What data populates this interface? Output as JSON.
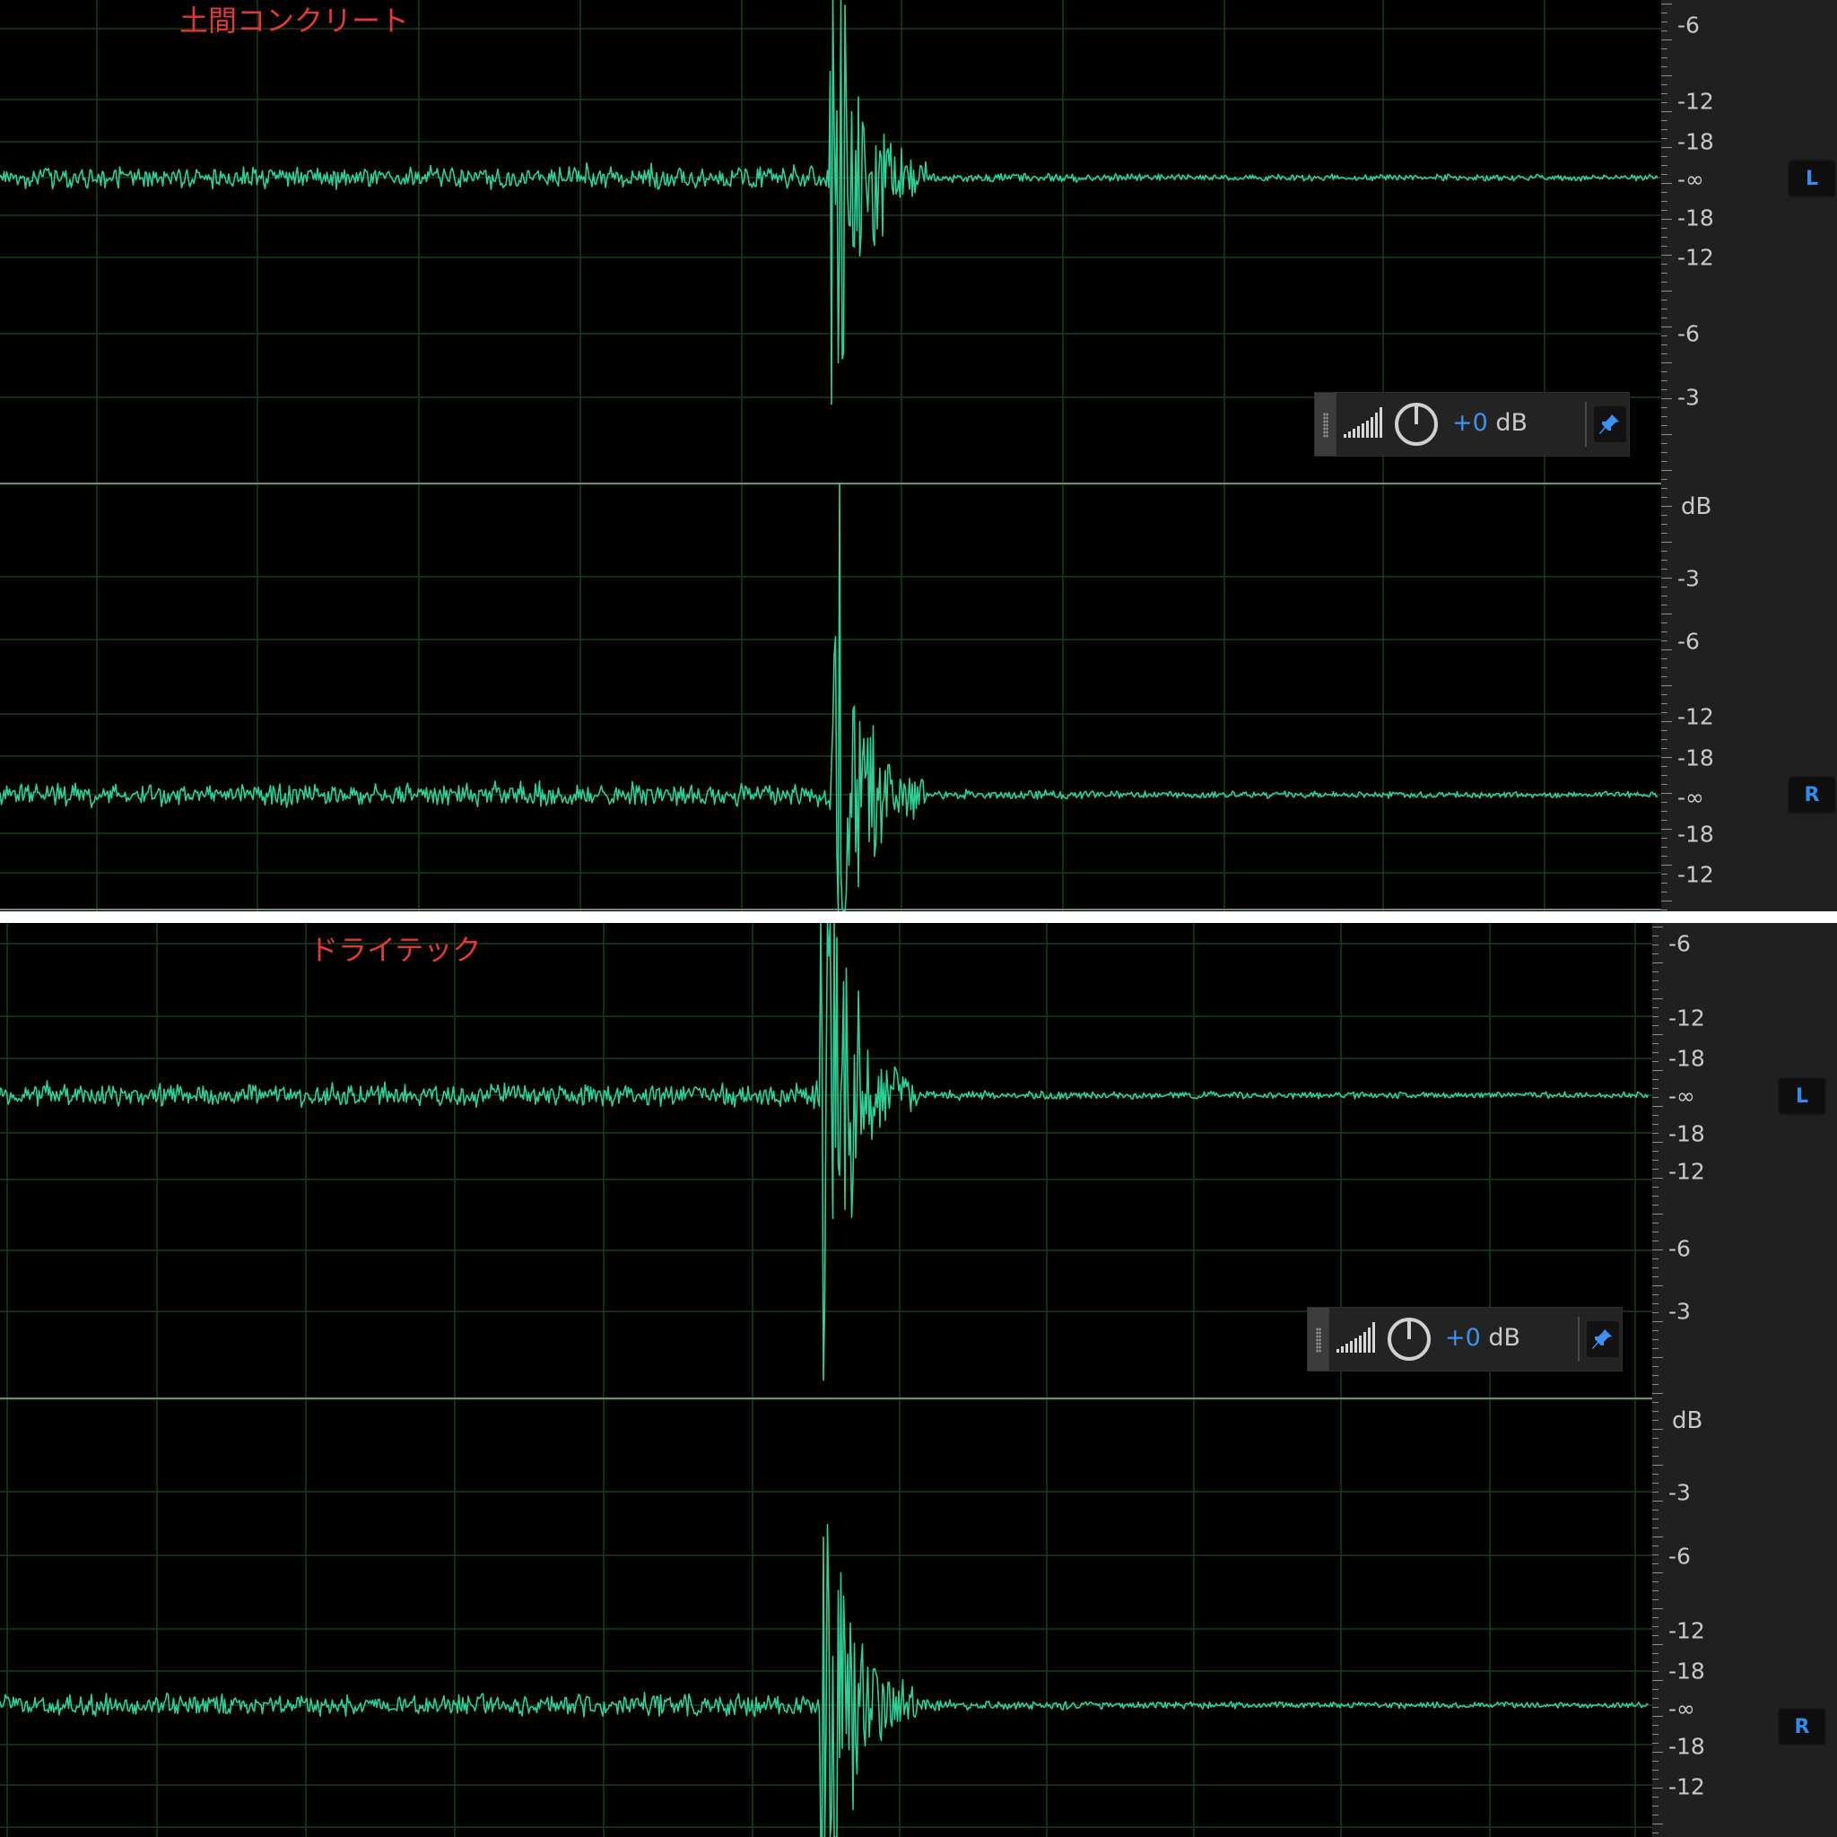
{
  "panels": [
    {
      "title": "土間コンクリート",
      "ruler": {
        "unit": "dB",
        "top_channel_labels": [
          "-6",
          "-12",
          "-18",
          "-∞",
          "-18",
          "-12",
          "-6",
          "-3"
        ],
        "bottom_channel_labels": [
          "-3",
          "-6",
          "-12",
          "-18",
          "-∞",
          "-18",
          "-12"
        ]
      },
      "channels": [
        "L",
        "R"
      ],
      "gain_hud": {
        "gain_value": "+0",
        "gain_unit": " dB"
      }
    },
    {
      "title": "ドライテック",
      "ruler": {
        "unit": "dB",
        "top_channel_labels": [
          "-6",
          "-12",
          "-18",
          "-∞",
          "-18",
          "-12",
          "-6",
          "-3"
        ],
        "bottom_channel_labels": [
          "-3",
          "-6",
          "-12",
          "-18",
          "-∞",
          "-18",
          "-12"
        ]
      },
      "channels": [
        "L",
        "R"
      ],
      "gain_hud": {
        "gain_value": "+0",
        "gain_unit": " dB"
      }
    }
  ],
  "colors": {
    "waveform": "#2ecf97",
    "grid": "#183f1e",
    "title": "#e23a33",
    "gain_value": "#3a93f2",
    "channel_label": "#2f8ef0",
    "pin_icon": "#3a93f2"
  },
  "icons": {
    "grip": "grip-dots-icon",
    "meter": "level-meter-icon",
    "knob": "gain-knob-icon",
    "pin": "pin-icon"
  }
}
